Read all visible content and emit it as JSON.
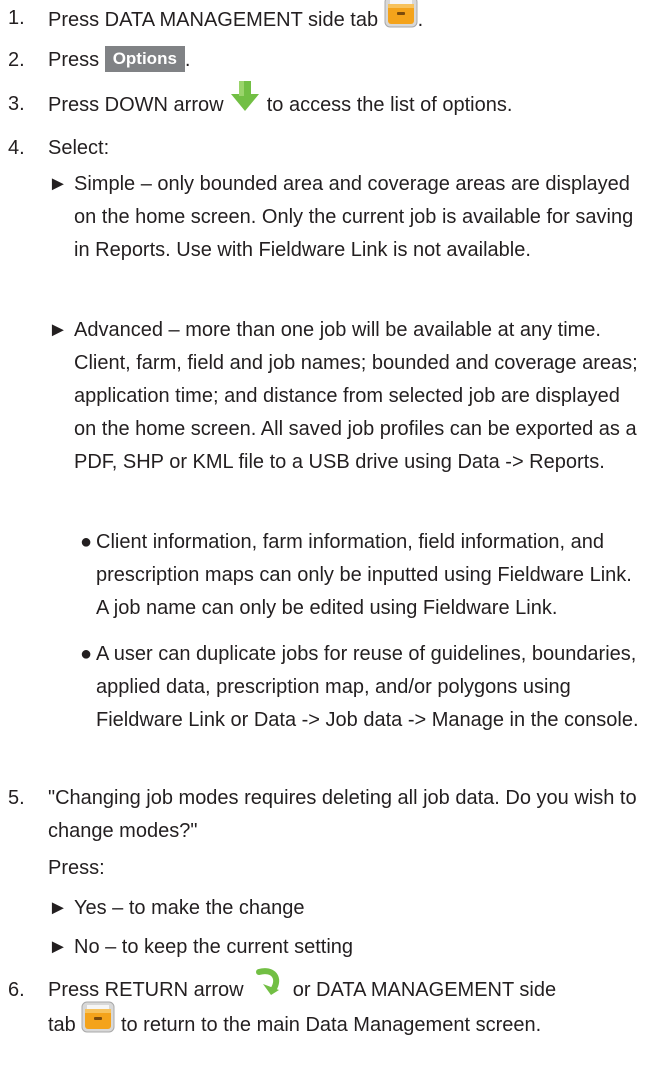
{
  "steps": [
    {
      "num": "1.",
      "pre": "Press DATA MANAGEMENT side tab",
      "post": "."
    },
    {
      "num": "2.",
      "pre": "Press",
      "button": "Options",
      "post": "."
    },
    {
      "num": "3.",
      "pre": "Press DOWN arrow",
      "post": "to access the list of options."
    },
    {
      "num": "4.",
      "text": "Select:"
    },
    {
      "num": "5.",
      "text": "\"Changing job modes requires deleting all job data. Do you wish to change modes?\"",
      "press": "Press:"
    },
    {
      "num": "6.",
      "pre": "Press RETURN arrow",
      "mid": "or DATA MANAGEMENT side",
      "mid2": "tab",
      "post": "to return to the main Data Management screen."
    }
  ],
  "select_options": [
    {
      "text": "Simple – only bounded area and coverage areas are displayed on the home screen. Only the current job is available for saving in Reports. Use with Fieldware Link is not available."
    },
    {
      "text": "Advanced – more than one job will be available at any time. Client, farm, field and job names; bounded and coverage areas; application time; and distance from selected job are displayed on the home screen. All saved job profiles can be exported as a PDF, SHP or KML file to a USB drive using Data -> Reports."
    }
  ],
  "advanced_bullets": [
    {
      "text": "Client information, farm information, field information, and prescription maps can only be inputted using Fieldware Link. A job name can only be edited using Fieldware Link."
    },
    {
      "text": "A user can duplicate jobs for reuse of guidelines, boundaries, applied data, prescription map, and/or polygons using Fieldware Link or Data -> Job data -> Manage in the console."
    }
  ],
  "press_options": [
    {
      "text": "Yes – to make the change"
    },
    {
      "text": "No – to keep the current setting"
    }
  ],
  "glyphs": {
    "triangle": "►",
    "bullet": "●"
  },
  "icons": {
    "data_management_tab": "filing-cabinet-icon",
    "down_arrow": "down-arrow-icon",
    "return_arrow": "return-arrow-icon"
  },
  "colors": {
    "text": "#231f20",
    "button_bg": "#808285",
    "cabinet": "#f4a31b",
    "down_arrow": "#72bf44",
    "return_arrow": "#72bf44"
  }
}
